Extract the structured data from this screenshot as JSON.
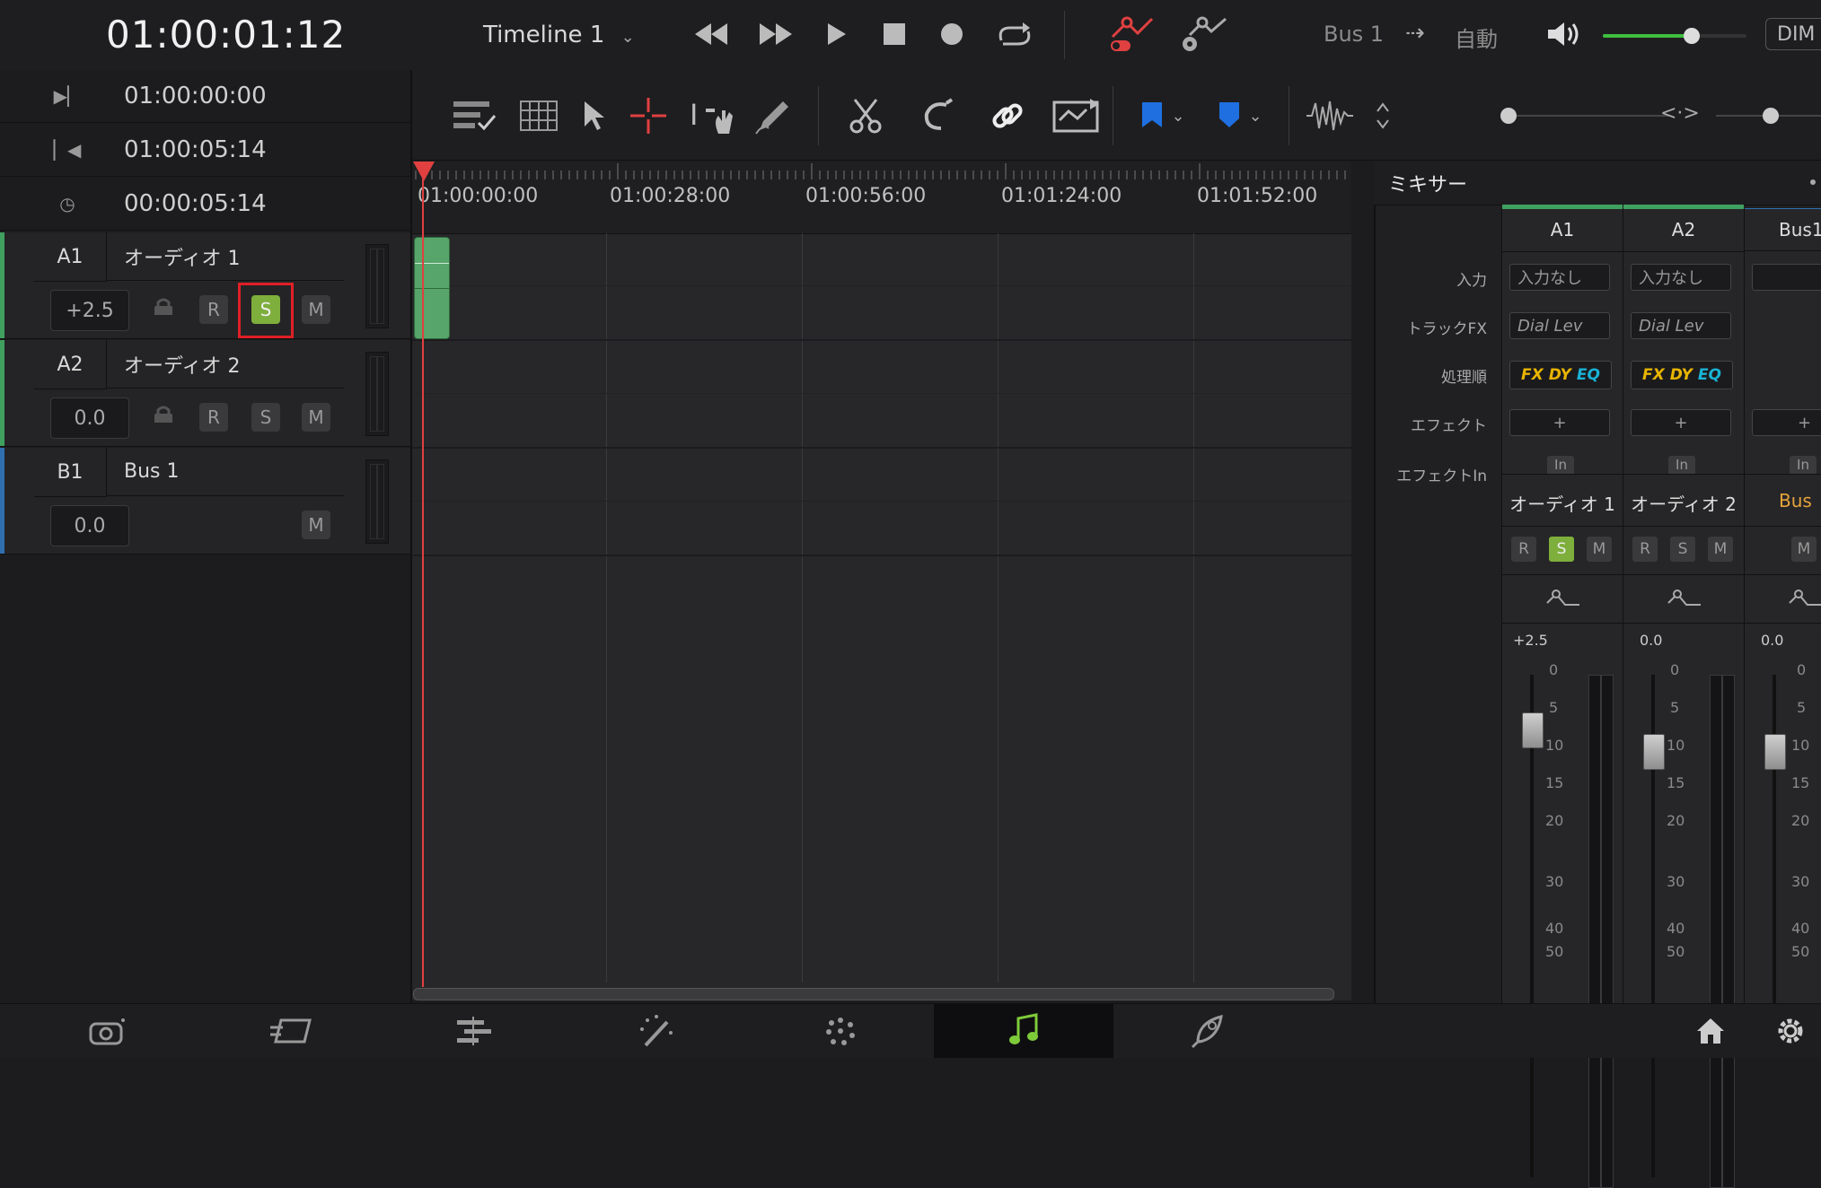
{
  "header": {
    "timecode": "01:00:01:12",
    "timeline_name": "Timeline 1",
    "bus_output": "Bus 1",
    "automation": "自動",
    "dim_label": "DIM",
    "volume_level_fraction": 0.62
  },
  "timecodes": {
    "in_point": "01:00:00:00",
    "out_point": "01:00:05:14",
    "duration": "00:00:05:14"
  },
  "tracks": [
    {
      "id": "A1",
      "name": "オーディオ 1",
      "volume": "+2.5",
      "r": "R",
      "s": "S",
      "m": "M",
      "color": "#3fa060",
      "solo": true
    },
    {
      "id": "A2",
      "name": "オーディオ 2",
      "volume": "0.0",
      "r": "R",
      "s": "S",
      "m": "M",
      "color": "#3fa060",
      "solo": false
    },
    {
      "id": "B1",
      "name": "Bus 1",
      "volume": "0.0",
      "m": "M",
      "color": "#2f6fb0"
    }
  ],
  "ruler": {
    "labels": [
      "01:00:00:00",
      "01:00:28:00",
      "01:00:56:00",
      "01:01:24:00",
      "01:01:52:00"
    ]
  },
  "mixer": {
    "title": "ミキサー",
    "row_labels": {
      "input": "入力",
      "track_fx": "トラックFX",
      "order": "処理順",
      "effects": "エフェクト",
      "effects_in": "エフェクトIn"
    },
    "channels": [
      {
        "head": "A1",
        "input": "入力なし",
        "track_fx": "Dial Lev",
        "fx": "FX",
        "dy": "DY",
        "eq": "EQ",
        "plus": "+",
        "in": "In",
        "name": "オーディオ 1",
        "r": "R",
        "s": "S",
        "m": "M",
        "vol": "+2.5",
        "solo": true,
        "color": "#3fa060"
      },
      {
        "head": "A2",
        "input": "入力なし",
        "track_fx": "Dial Lev",
        "fx": "FX",
        "dy": "DY",
        "eq": "EQ",
        "plus": "+",
        "in": "In",
        "name": "オーディオ 2",
        "r": "R",
        "s": "S",
        "m": "M",
        "vol": "0.0",
        "solo": false,
        "color": "#3fa060"
      },
      {
        "head": "Bus1",
        "plus": "+",
        "in": "In",
        "name": "Bus ",
        "m": "M",
        "vol": "0.0",
        "color": "#2f6fb0"
      }
    ],
    "scale": [
      "0",
      "5",
      "10",
      "15",
      "20",
      "30",
      "40",
      "50"
    ]
  },
  "accent_colors": {
    "solo_on": "#7eae3c",
    "playhead": "#e04040",
    "highlight": "#e01f26",
    "fairlight_active": "#7ecb3a"
  }
}
